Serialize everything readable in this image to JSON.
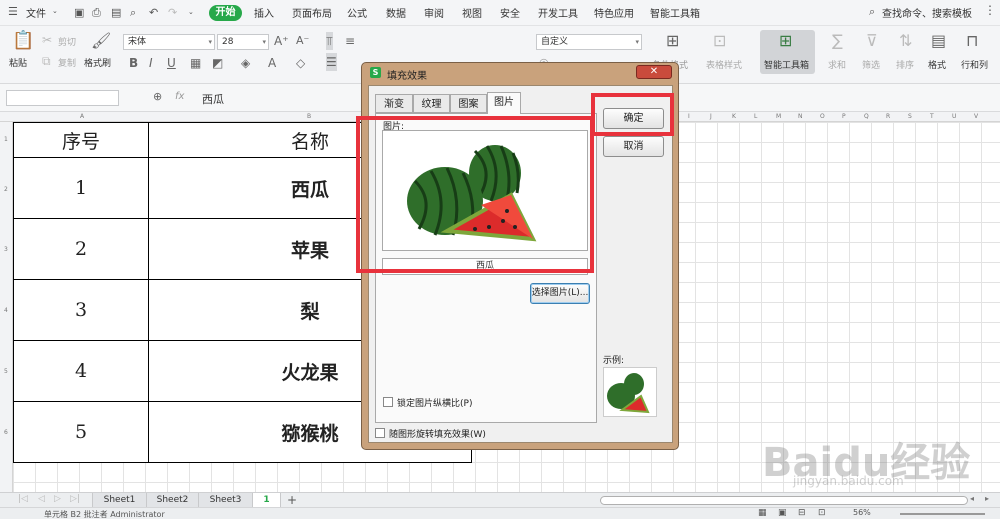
{
  "menu": {
    "file": "文件",
    "tabs": [
      "开始",
      "插入",
      "页面布局",
      "公式",
      "数据",
      "审阅",
      "视图",
      "安全",
      "开发工具",
      "特色应用",
      "智能工具箱"
    ],
    "search": "查找命令、搜索模板"
  },
  "toolbar": {
    "paste": "粘贴",
    "cut": "剪切",
    "copy": "复制",
    "format_painter": "格式刷",
    "font": "宋体",
    "font_size": "28",
    "number_format": "自定义",
    "conditional_format": "条件格式",
    "table_style": "表格样式",
    "smart_toolbox": "智能工具箱",
    "sum": "求和",
    "filter": "筛选",
    "sort": "排序",
    "format": "格式",
    "row_col": "行和列"
  },
  "formula_bar": {
    "fx": "fx",
    "value": "西瓜"
  },
  "table": {
    "header": [
      "序号",
      "名称"
    ],
    "rows": [
      [
        "1",
        "西瓜"
      ],
      [
        "2",
        "苹果"
      ],
      [
        "3",
        "梨"
      ],
      [
        "4",
        "火龙果"
      ],
      [
        "5",
        "猕猴桃"
      ]
    ]
  },
  "sheets": [
    "Sheet1",
    "Sheet2",
    "Sheet3"
  ],
  "active_page": "1",
  "status": {
    "left": "单元格 B2 批注者 Administrator",
    "zoom": "56%"
  },
  "dialog": {
    "title": "填充效果",
    "tabs": [
      "渐变",
      "纹理",
      "图案",
      "图片"
    ],
    "picture_label": "图片:",
    "picture_name": "西瓜",
    "select_picture": "选择图片(L)...",
    "lock_ratio": "锁定图片纵横比(P)",
    "rotate_with_shape": "随图形旋转填充效果(W)",
    "sample": "示例:",
    "ok": "确定",
    "cancel": "取消"
  },
  "watermark": {
    "text": "Baidu经验",
    "url": "jingyan.baidu.com"
  },
  "colors": {
    "accent_green": "#27a84a",
    "highlight_red": "#e8323c",
    "dialog_frame": "#c9a27c"
  }
}
